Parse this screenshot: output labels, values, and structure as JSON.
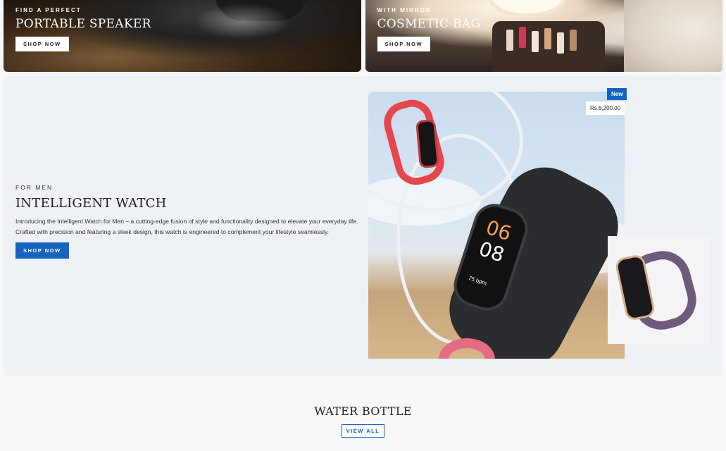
{
  "banners": [
    {
      "eyebrow": "FIND A PERFECT",
      "title": "PORTABLE SPEAKER",
      "button": "SHOP NOW"
    },
    {
      "eyebrow": "WITH MIRROR",
      "title": "COSMETIC BAG",
      "button": "SHOP NOW"
    }
  ],
  "feature": {
    "eyebrow": "FOR MEN",
    "title": "INTELLIGENT WATCH",
    "description": "Introducing the Intelligent Watch for Men – a cutting-edge fusion of style and functionality designed to elevate your everyday life. Crafted with precision and featuring a sleek design, this watch is engineered to complement your lifestyle seamlessly.",
    "button": "SHOP NOW",
    "badge": "New",
    "price": "Rs.6,200.00",
    "watch_time_hours": "06",
    "watch_time_minutes": "08",
    "watch_bpm": "75 bpm"
  },
  "section": {
    "title": "WATER BOTTLE",
    "view_all": "VIEW ALL"
  },
  "colors": {
    "accent": "#1565c0",
    "feature_bg": "#eef1f6"
  }
}
